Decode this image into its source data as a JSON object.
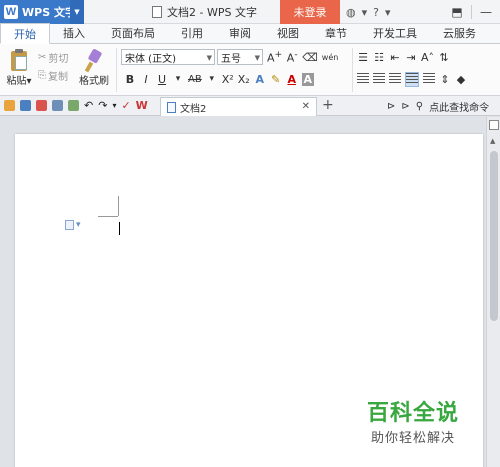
{
  "titlebar": {
    "app_name": "WPS 文字",
    "logo_letter": "W",
    "doc_title": "文档2 - WPS 文字",
    "login_label": "未登录",
    "help_label": "?"
  },
  "tabs": [
    {
      "label": "开始",
      "active": true
    },
    {
      "label": "插入",
      "active": false
    },
    {
      "label": "页面布局",
      "active": false
    },
    {
      "label": "引用",
      "active": false
    },
    {
      "label": "审阅",
      "active": false
    },
    {
      "label": "视图",
      "active": false
    },
    {
      "label": "章节",
      "active": false
    },
    {
      "label": "开发工具",
      "active": false
    },
    {
      "label": "云服务",
      "active": false
    }
  ],
  "ribbon": {
    "paste_label": "粘贴",
    "cut_label": "剪切",
    "copy_label": "复制",
    "format_painter_label": "格式刷",
    "font_name": "宋体 (正文)",
    "font_size": "五号",
    "bold": "B",
    "italic": "I",
    "underline": "U",
    "strikethrough": "AB",
    "superscript": "X²",
    "subscript": "X₂",
    "font_color_letter": "A",
    "phonetic_label": "wén"
  },
  "quickbar": {
    "doc_tab_label": "文档2",
    "search_command_label": "点此查找命令"
  },
  "watermark": {
    "line1": "百科全说",
    "line2": "助你轻松解决"
  }
}
